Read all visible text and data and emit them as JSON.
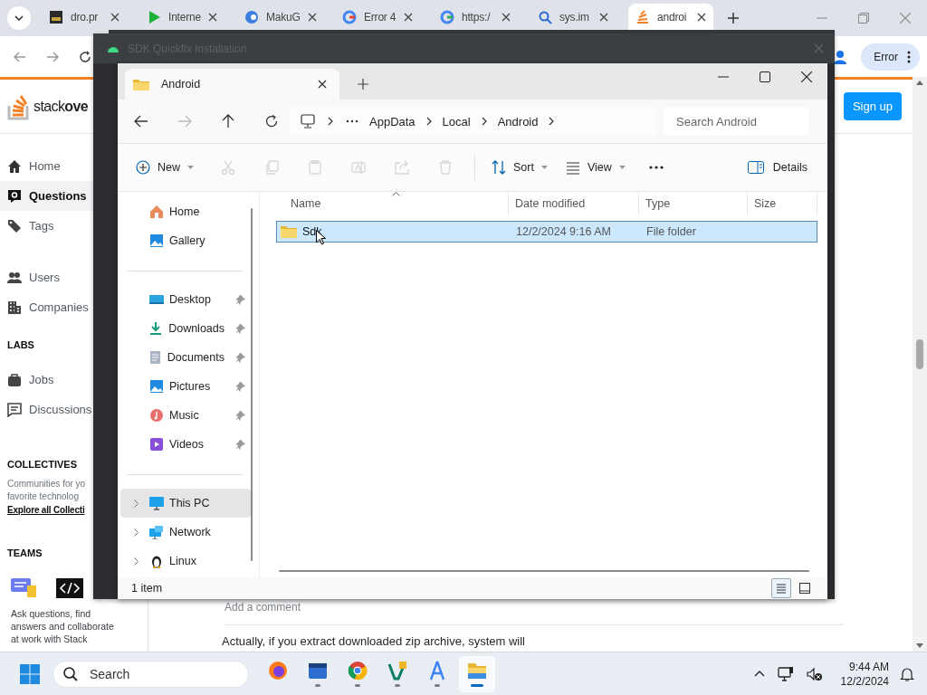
{
  "browser": {
    "tabs": [
      {
        "title": "dro.pr",
        "selected": false
      },
      {
        "title": "Interne",
        "selected": false
      },
      {
        "title": "MakuG",
        "selected": false
      },
      {
        "title": "Error 4",
        "selected": false
      },
      {
        "title": "https:/",
        "selected": false
      },
      {
        "title": "sys.im",
        "selected": false
      },
      {
        "title": "androi",
        "selected": true
      }
    ],
    "profile_button": "Error"
  },
  "stackoverflow": {
    "logo": "stack**ove**",
    "sign_up": "Sign up",
    "nav_groups": [
      [
        {
          "label": "Home",
          "selected": false
        },
        {
          "label": "Questions",
          "selected": true
        },
        {
          "label": "Tags",
          "selected": false
        }
      ],
      [
        {
          "label": "Users",
          "selected": false
        },
        {
          "label": "Companies",
          "selected": false
        }
      ]
    ],
    "labs": {
      "heading": "LABS",
      "items": [
        {
          "label": "Jobs",
          "selected": false
        },
        {
          "label": "Discussions",
          "selected": false
        }
      ]
    },
    "collectives": {
      "heading": "COLLECTIVES",
      "lines": [
        "Communities for yo",
        "favorite technolog"
      ],
      "link": "Explore all Collecti"
    },
    "teams": {
      "heading": "TEAMS",
      "lines": [
        "Ask questions, find",
        "answers and collaborate",
        "at work with Stack"
      ]
    },
    "add_comment": "Add a comment",
    "answer_line": "Actually, if you extract downloaded zip archive, system will"
  },
  "background_window": {
    "title": "SDK Quickfix Installation"
  },
  "explorer": {
    "tab": "Android",
    "breadcrumb": [
      "AppData",
      "Local",
      "Android"
    ],
    "search_placeholder": "Search Android",
    "toolbar": [
      {
        "kind": "new",
        "label": "New",
        "disabled": false
      },
      {
        "kind": "cut",
        "disabled": true
      },
      {
        "kind": "copy",
        "disabled": true
      },
      {
        "kind": "paste",
        "disabled": true
      },
      {
        "kind": "rename",
        "disabled": true
      },
      {
        "kind": "share",
        "disabled": true
      },
      {
        "kind": "delete",
        "disabled": true
      },
      {
        "kind": "sort",
        "label": "Sort",
        "disabled": false
      },
      {
        "kind": "view",
        "label": "View",
        "disabled": false
      },
      {
        "kind": "more",
        "disabled": false
      }
    ],
    "details_button": "Details",
    "nav_groups": [
      [
        {
          "label": "Home",
          "pinned": false,
          "expandable": false,
          "selected": false
        },
        {
          "label": "Gallery",
          "pinned": false,
          "expandable": false,
          "selected": false
        }
      ],
      [
        {
          "label": "Desktop",
          "pinned": true,
          "expandable": false,
          "selected": false
        },
        {
          "label": "Downloads",
          "pinned": true,
          "expandable": false,
          "selected": false
        },
        {
          "label": "Documents",
          "pinned": true,
          "expandable": false,
          "selected": false
        },
        {
          "label": "Pictures",
          "pinned": true,
          "expandable": false,
          "selected": false
        },
        {
          "label": "Music",
          "pinned": true,
          "expandable": false,
          "selected": false
        },
        {
          "label": "Videos",
          "pinned": true,
          "expandable": false,
          "selected": false
        }
      ],
      [
        {
          "label": "This PC",
          "pinned": false,
          "expandable": true,
          "selected": true
        },
        {
          "label": "Network",
          "pinned": false,
          "expandable": true,
          "selected": false
        },
        {
          "label": "Linux",
          "pinned": false,
          "expandable": true,
          "selected": false
        }
      ]
    ],
    "columns": [
      "Name",
      "Date modified",
      "Type",
      "Size"
    ],
    "rows": [
      {
        "name": "Sdk",
        "date_modified": "12/2/2024 9:16 AM",
        "type": "File folder",
        "selected": true
      }
    ],
    "status": "1 item",
    "views": [
      {
        "kind": "details",
        "selected": true
      },
      {
        "kind": "tiles",
        "selected": false
      }
    ]
  },
  "taskbar": {
    "search_placeholder": "Search",
    "apps": [
      {
        "kind": "fox",
        "running": false,
        "selected": false
      },
      {
        "kind": "cabinet",
        "running": true,
        "selected": false
      },
      {
        "kind": "wheel",
        "running": true,
        "selected": false
      },
      {
        "kind": "editor",
        "running": true,
        "selected": false
      },
      {
        "kind": "pen",
        "running": true,
        "selected": false
      },
      {
        "kind": "folder",
        "running": true,
        "selected": true
      }
    ],
    "time": "9:44 AM",
    "date": "12/2/2024"
  }
}
